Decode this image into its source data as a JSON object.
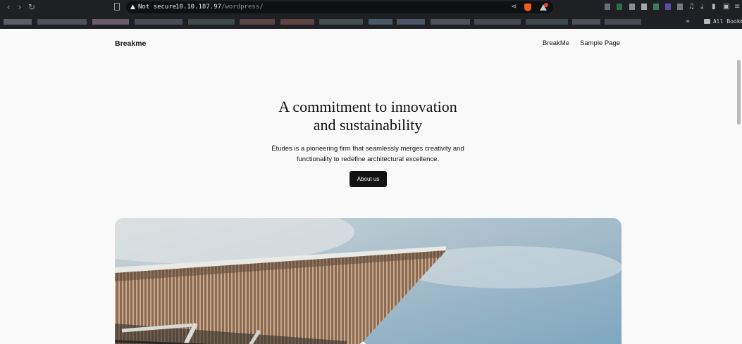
{
  "browser": {
    "security_label": "Not secure",
    "url_host": "10.10.187.97",
    "url_path": "/wordpress/",
    "all_bookmarks_label": "All Bookma",
    "icons": [
      "back-icon",
      "forward-icon",
      "reload-icon",
      "bookmark-icon",
      "warning-icon",
      "share-icon",
      "brave-shields-icon",
      "brave-rewards-icon",
      "extensions-icon",
      "downloads-icon",
      "sidebar-icon",
      "wallet-icon",
      "menu-icon",
      "folder-icon"
    ]
  },
  "site": {
    "title": "Breakme",
    "nav": [
      "BreakMe",
      "Sample Page"
    ]
  },
  "hero": {
    "title_line1": "A commitment to innovation",
    "title_line2": "and sustainability",
    "description_line1": "Études is a pioneering firm that seamlessly merges creativity and",
    "description_line2": "functionality to redefine architectural excellence.",
    "cta_label": "About us"
  },
  "colors": {
    "page_bg": "#f9f9f9",
    "chrome_bg": "#1f2023",
    "text": "#111111",
    "button_bg": "#111111",
    "sky": "#8fb3c9"
  }
}
